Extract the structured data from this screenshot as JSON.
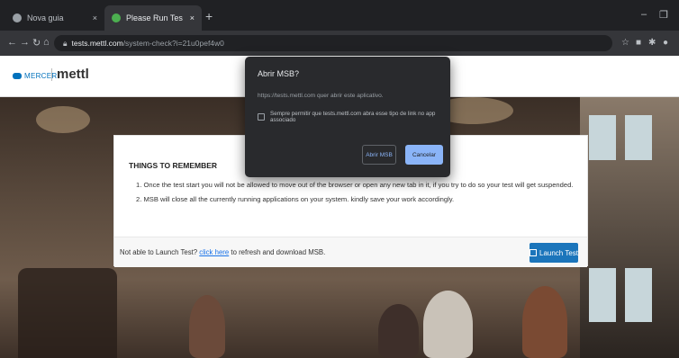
{
  "browser": {
    "tabs": [
      {
        "label": "Nova guia",
        "active": false,
        "favicon_color": "#9aa0a6"
      },
      {
        "label": "Please Run Test in MSB",
        "active": true,
        "favicon_color": "#4caf50"
      }
    ],
    "close_glyph": "×",
    "new_tab_glyph": "+",
    "url_host": "tests.mettl.com",
    "url_path": "/system-check?i=21u0pef4w0",
    "window_controls": {
      "minimize": "–",
      "restore": "❐"
    }
  },
  "site": {
    "mercer_logo": "MERCER",
    "mettl_logo": "mettl"
  },
  "card": {
    "title": "THINGS TO REMEMBER",
    "items": [
      "1. Once the test start you will not be allowed to move out of the browser or open any new tab in it, if you try to do so your test will get suspended.",
      "2. MSB will close all the currently running applications on your system. kindly save your work accordingly."
    ],
    "footer_prefix": "Not able to Launch Test?",
    "footer_link": "click here",
    "footer_suffix": "to refresh and download MSB.",
    "launch_label": "Launch Test"
  },
  "dialog": {
    "title": "Abrir MSB?",
    "message": "https://tests.mettl.com quer abrir este aplicativo.",
    "checkbox_label": "Sempre permitir que tests.mettl.com abra esse tipo de link no app associado",
    "checkbox_checked": false,
    "open_label": "Abrir MSB",
    "cancel_label": "Cancelar"
  },
  "colors": {
    "accent": "#1b75bb",
    "dialog_bg": "#292a2d",
    "dialog_primary": "#8ab4f8"
  }
}
